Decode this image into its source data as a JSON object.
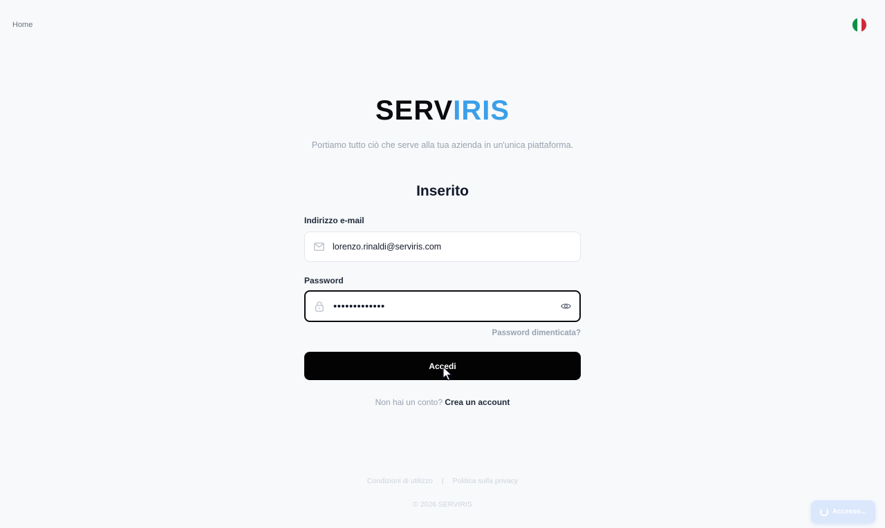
{
  "nav": {
    "home_label": "Home"
  },
  "language": {
    "flag_colors": [
      "#009246",
      "#ffffff",
      "#ce2b37"
    ],
    "icon": "italy-flag-icon"
  },
  "brand": {
    "logo_part1": "SERV",
    "logo_part2": "IRIS",
    "color_dark": "#0b0b0f",
    "color_accent": "#3b9fe8"
  },
  "tagline": "Portiamo tutto ciò che serve alla tua azienda in un'unica piattaforma.",
  "form": {
    "title": "Inserito",
    "email": {
      "label": "Indirizzo e-mail",
      "value": "lorenzo.rinaldi@serviris.com",
      "icon": "mail-icon"
    },
    "password": {
      "label": "Password",
      "value": "•••••••••••••",
      "icon": "lock-icon",
      "toggle_icon": "eye-icon"
    },
    "forgot_label": "Password dimenticata?",
    "submit_label": "Accedi",
    "signup_prompt": "Non hai un conto?",
    "signup_link": "Crea un account"
  },
  "footer": {
    "terms": "Condizioni di utilizzo",
    "separator": "|",
    "privacy": "Politica sulla privacy",
    "copyright": "© 2026 SERVIRIS"
  },
  "toast": {
    "label": "Accesso..."
  }
}
